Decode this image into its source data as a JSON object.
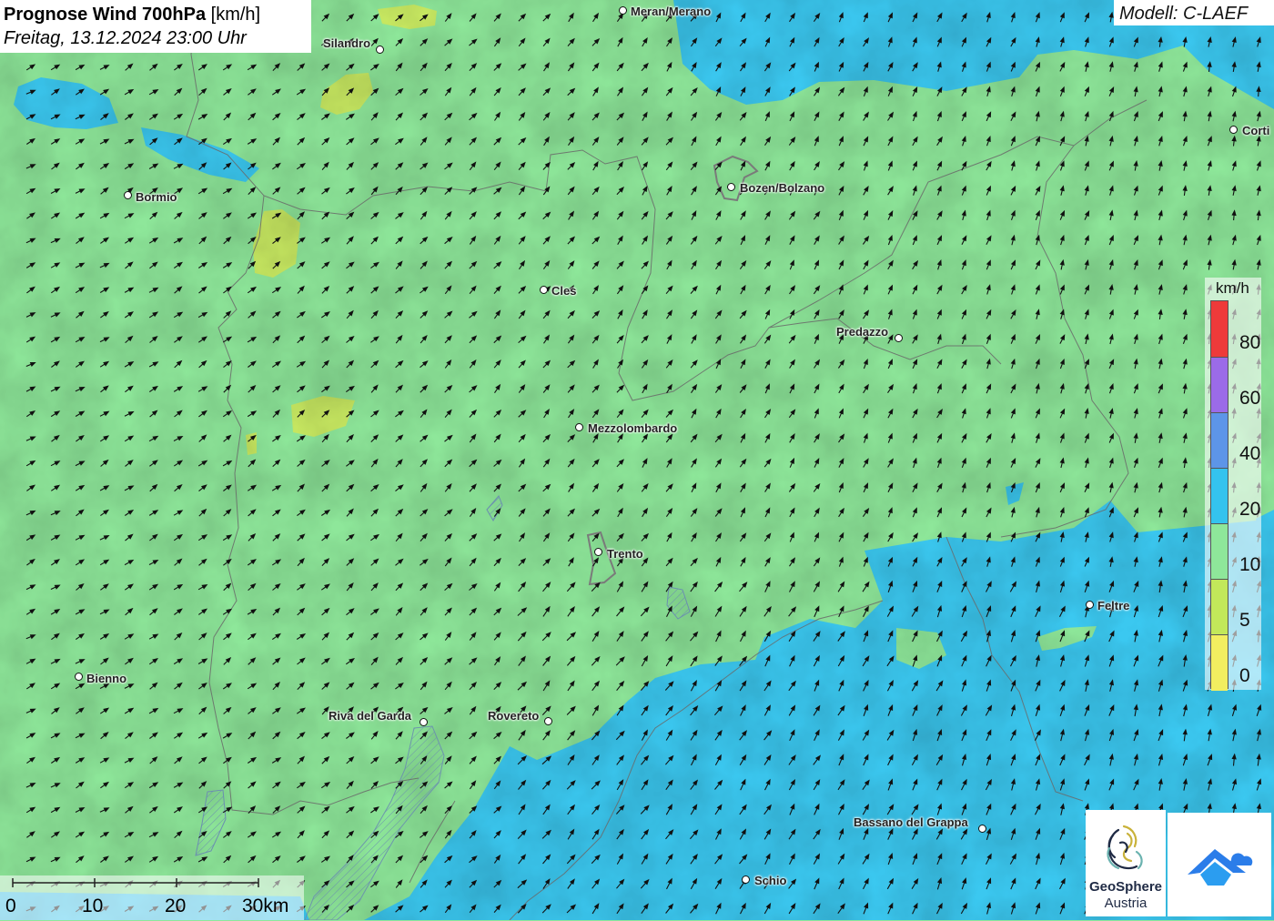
{
  "header": {
    "title_bold": "Prognose Wind 700hPa",
    "title_unit": "[km/h]",
    "subtitle": "Freitag, 13.12.2024 23:00 Uhr",
    "model": "Modell: C-LAEF"
  },
  "cities": [
    {
      "name": "Meran/Merano"
    },
    {
      "name": "Silandro"
    },
    {
      "name": "Bormio"
    },
    {
      "name": "Bozen/Bolzano"
    },
    {
      "name": "Corti"
    },
    {
      "name": "Cles"
    },
    {
      "name": "Predazzo"
    },
    {
      "name": "Mezzolombardo"
    },
    {
      "name": "Trento"
    },
    {
      "name": "Feltre"
    },
    {
      "name": "Bienno"
    },
    {
      "name": "Riva del Garda"
    },
    {
      "name": "Rovereto"
    },
    {
      "name": "Bassano del Grappa"
    },
    {
      "name": "Schio"
    }
  ],
  "legend": {
    "title": "km/h",
    "levels": [
      {
        "label": "80",
        "color": "#ee3a3a"
      },
      {
        "label": "60",
        "color": "#9b6be8"
      },
      {
        "label": "40",
        "color": "#5d95e8"
      },
      {
        "label": "20",
        "color": "#34c3ee"
      },
      {
        "label": "10",
        "color": "#8ee79a"
      },
      {
        "label": "5",
        "color": "#c2e85a"
      },
      {
        "label": "0",
        "color": "#f2ee60"
      }
    ]
  },
  "scale": {
    "labels": [
      "0",
      "10",
      "20",
      "30km"
    ]
  },
  "logos": {
    "geosphere_line1": "GeoSphere",
    "geosphere_line2": "Austria"
  },
  "colors": {
    "wind_10_20": "#8ee79a",
    "wind_20_40": "#3bc8f0",
    "wind_5_10": "#c9ea62",
    "arrow": "#111111"
  }
}
